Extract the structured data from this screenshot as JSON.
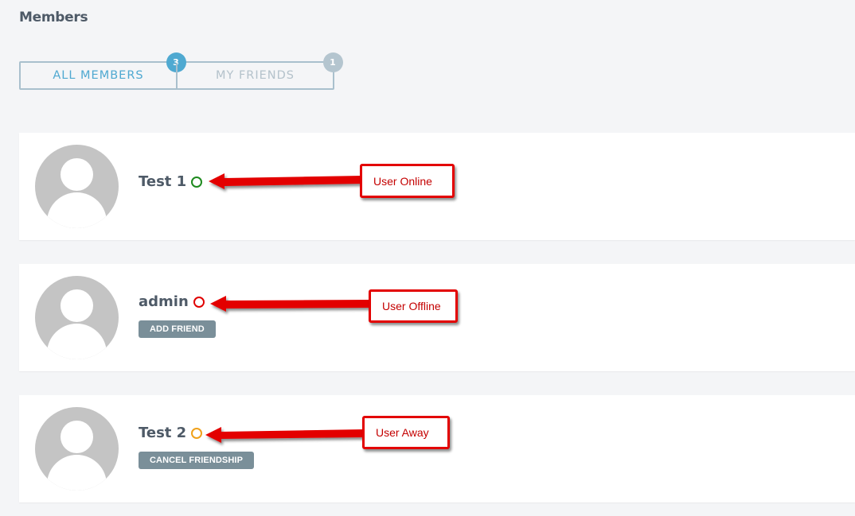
{
  "page": {
    "title": "Members"
  },
  "tabs": [
    {
      "label": "ALL MEMBERS",
      "count": "3",
      "active": true,
      "badge_color": "#4fa9d1"
    },
    {
      "label": "MY FRIENDS",
      "count": "1",
      "active": false,
      "badge_color": "#b4c5cf"
    }
  ],
  "members": [
    {
      "name": "Test 1",
      "status": "online",
      "status_color": "#1e8a1e",
      "action": "",
      "annotation": "User Online"
    },
    {
      "name": "admin",
      "status": "offline",
      "status_color": "#e00000",
      "action": "ADD FRIEND",
      "annotation": "User Offline"
    },
    {
      "name": "Test 2",
      "status": "away",
      "status_color": "#f0a11a",
      "action": "CANCEL FRIENDSHIP",
      "annotation": "User Away"
    }
  ],
  "colors": {
    "background": "#f4f5f7",
    "card": "#ffffff",
    "accent": "#4fa9d1",
    "button": "#7a8f99",
    "annotation": "#e30000"
  }
}
